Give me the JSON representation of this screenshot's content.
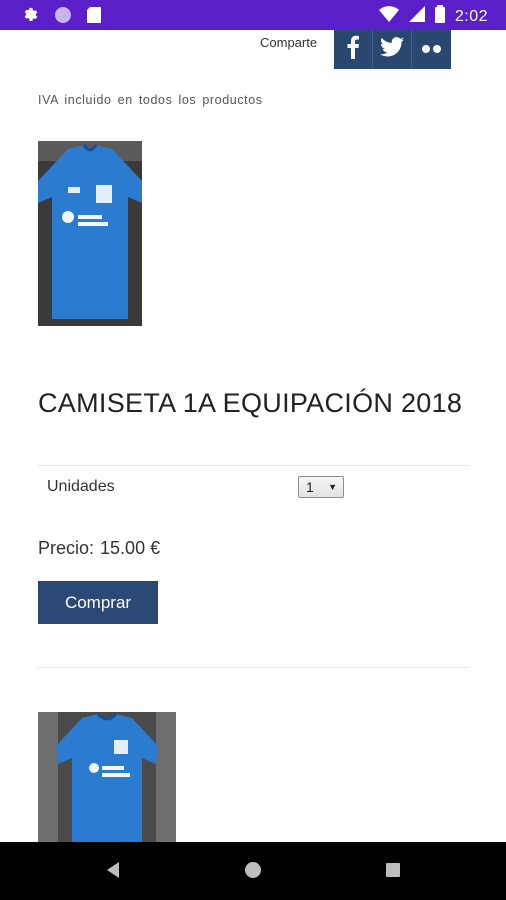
{
  "status_bar": {
    "time": "2:02",
    "left_icons": [
      "settings-icon",
      "circle-icon",
      "sd-card-icon"
    ],
    "right_icons": [
      "wifi-icon",
      "signal-icon",
      "battery-icon"
    ]
  },
  "share": {
    "label": "Comparte",
    "buttons": [
      {
        "name": "facebook",
        "glyph": "f"
      },
      {
        "name": "twitter",
        "glyph": ""
      },
      {
        "name": "flickr",
        "glyph": "••"
      }
    ]
  },
  "notice": "IVA incluido en todos los productos",
  "products": [
    {
      "title": "CAMISETA 1A EQUIPACIÓN 2018",
      "units_label": "Unidades",
      "units_value": "1",
      "price_label": "Precio:",
      "price_value": "15.00 €",
      "buy_label": "Comprar"
    }
  ],
  "nav_bar": {
    "buttons": [
      "back-icon",
      "home-icon",
      "recents-icon"
    ]
  },
  "colors": {
    "status_bar": "#5a1fc9",
    "brand_blue": "#2a4a75",
    "shirt_blue": "#2b7bd1"
  }
}
